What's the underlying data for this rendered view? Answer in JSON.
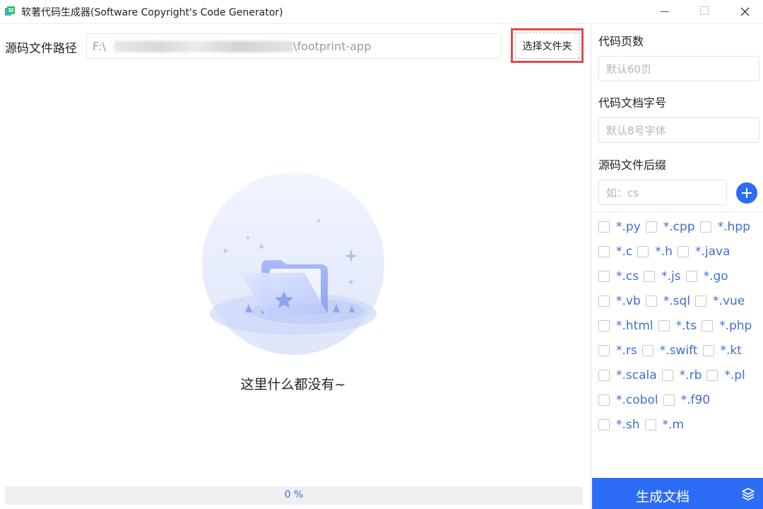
{
  "window": {
    "title": "软著代码生成器(Software Copyright's Code Generator)"
  },
  "source_path": {
    "label": "源码文件路径",
    "value_prefix": "F:\\",
    "value_suffix": "\\footprint-app",
    "select_button": "选择文件夹"
  },
  "empty_state": {
    "text": "这里什么都没有~"
  },
  "progress": {
    "text": "0 %",
    "value": 0
  },
  "sidebar": {
    "pages_label": "代码页数",
    "pages_placeholder": "默认60页",
    "font_label": "代码文档字号",
    "font_placeholder": "默认8号字体",
    "suffix_label": "源码文件后缀",
    "suffix_placeholder": "如：cs",
    "extension_rows": [
      [
        "*.py",
        "*.cpp",
        "*.hpp"
      ],
      [
        "*.c",
        "*.h",
        "*.java"
      ],
      [
        "*.cs",
        "*.js",
        "*.go"
      ],
      [
        "*.vb",
        "*.sql",
        "*.vue"
      ],
      [
        "*.html",
        "*.ts",
        "*.php"
      ],
      [
        "*.rs",
        "*.swift",
        "*.kt"
      ],
      [
        "*.scala",
        "*.rb",
        "*.pl"
      ],
      [
        "*.cobol",
        "*.f90"
      ],
      [
        "*.sh",
        "*.m"
      ]
    ],
    "generate_button": "生成文档"
  },
  "colors": {
    "accent": "#2d6df6",
    "link_text": "#3e6fd8",
    "highlight_border": "#e5484d"
  }
}
